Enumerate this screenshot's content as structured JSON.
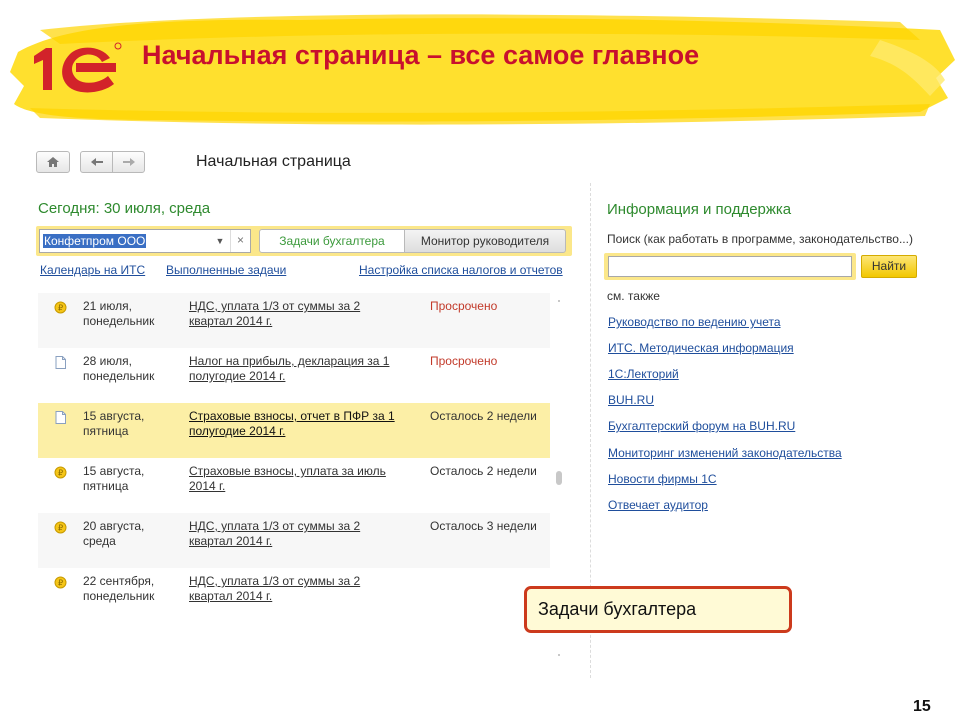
{
  "header": {
    "title": "Начальная страница – все самое главное",
    "logo_text": "1С"
  },
  "toolbar": {
    "home_icon": "home-icon",
    "back_icon": "arrow-left-icon",
    "forward_icon": "arrow-right-icon",
    "page_heading": "Начальная страница"
  },
  "left_panel": {
    "today": "Сегодня: 30 июля, среда",
    "org_value": "Конфетпром ООО",
    "tabs": [
      "Задачи бухгалтера",
      "Монитор руководителя"
    ],
    "links": [
      "Календарь на ИТС",
      "Выполненные задачи",
      "Настройка списка налогов и отчетов"
    ],
    "tasks": [
      {
        "icon": "coin-icon",
        "date_1": "21 июля,",
        "date_2": "понедельник",
        "task_1": "НДС, уплата 1/3 от суммы за 2",
        "task_2": "квартал 2014 г.",
        "status": "Просрочено"
      },
      {
        "icon": "document-icon",
        "date_1": "28 июля,",
        "date_2": "понедельник",
        "task_1": "Налог на прибыль, декларация за 1",
        "task_2": "полугодие 2014 г.",
        "status": "Просрочено"
      },
      {
        "icon": "document-icon",
        "date_1": "15 августа,",
        "date_2": "пятница",
        "task_1": "Страховые взносы, отчет в ПФР за 1",
        "task_2": "полугодие 2014 г.",
        "status": "Осталось 2 недели"
      },
      {
        "icon": "coin-icon",
        "date_1": "15 августа,",
        "date_2": "пятница",
        "task_1": "Страховые взносы, уплата за июль",
        "task_2": "2014 г.",
        "status": "Осталось 2 недели"
      },
      {
        "icon": "coin-icon",
        "date_1": "20 августа,",
        "date_2": "среда",
        "task_1": "НДС, уплата 1/3 от суммы за 2",
        "task_2": "квартал 2014 г.",
        "status": "Осталось 3 недели"
      },
      {
        "icon": "coin-icon",
        "date_1": "22 сентября,",
        "date_2": "понедельник",
        "task_1": "НДС, уплата 1/3 от суммы за 2",
        "task_2": "квартал 2014 г.",
        "status": ""
      }
    ]
  },
  "right_panel": {
    "title": "Информация и поддержка",
    "search_label": "Поиск (как работать в программе, законодательство...)",
    "search_value": "",
    "find_button": "Найти",
    "see_also": "см. также",
    "links": [
      "Руководство по ведению учета",
      "ИТС. Методическая информация",
      "1С:Лекторий",
      "BUH.RU",
      "Бухгалтерский форум на BUH.RU",
      "Мониторинг изменений законодательства",
      "Новости фирмы 1С",
      "Отвечает аудитор"
    ]
  },
  "callout": {
    "text": "Задачи бухгалтера"
  },
  "page_number": "15",
  "colors": {
    "title_red": "#c8102e",
    "green_heading": "#2e8a2e",
    "link_blue": "#1f4e9c",
    "overdue_red": "#c23a2a",
    "highlight_yellow": "#fcefa6",
    "callout_border": "#cc3a1c"
  }
}
